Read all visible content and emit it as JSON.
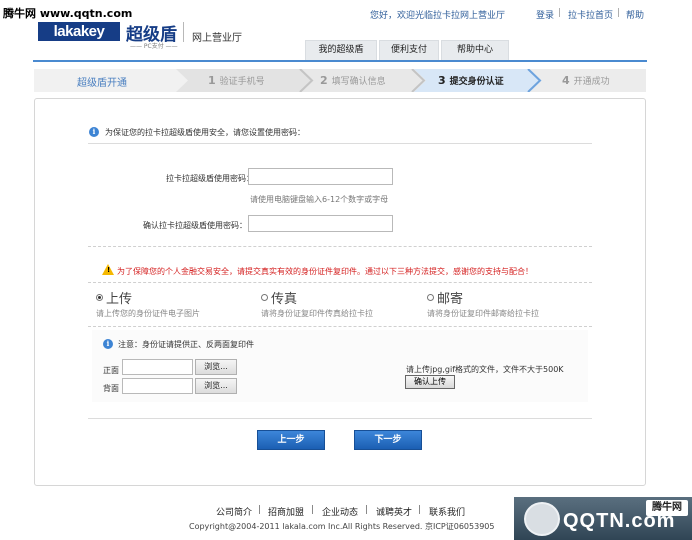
{
  "watermark": {
    "top_left": "腾牛网 www.qqtn.com",
    "bottom_right_logo": "QQTN.com",
    "bottom_right_badge": "腾牛网"
  },
  "header": {
    "logo_text": "lakakey",
    "logo_cn": "超级盾",
    "logo_sub": "—— PC支付 ——",
    "hall": "网上营业厅",
    "greeting": "您好，欢迎光临拉卡拉网上营业厅",
    "login": "登录",
    "home": "拉卡拉首页",
    "help": "帮助",
    "sep": "|",
    "nav_tabs": [
      "我的超级盾",
      "便利支付",
      "帮助中心"
    ]
  },
  "steps": {
    "title": "超级盾开通",
    "items": [
      {
        "num": "1",
        "label": "验证手机号"
      },
      {
        "num": "2",
        "label": "填写确认信息"
      },
      {
        "num": "3",
        "label": "提交身份认证"
      },
      {
        "num": "4",
        "label": "开通成功"
      }
    ],
    "active_index": 2
  },
  "form": {
    "intro": "为保证您的拉卡拉超级盾使用安全，请您设置使用密码：",
    "password_label": "拉卡拉超级盾使用密码：",
    "password_hint": "请使用电脑键盘输入6-12个数字或字母",
    "confirm_label": "确认拉卡拉超级盾使用密码：",
    "warning": "为了保障您的个人金融交易安全，请提交真实有效的身份证件复印件。通过以下三种方法提交，感谢您的支持与配合！"
  },
  "methods": [
    {
      "title": "上传",
      "desc": "请上传您的身份证件电子图片",
      "selected": true
    },
    {
      "title": "传真",
      "desc": "请将身份证复印件传真给拉卡拉",
      "selected": false
    },
    {
      "title": "邮寄",
      "desc": "请将身份证复印件邮寄给拉卡拉",
      "selected": false
    }
  ],
  "upload": {
    "notice": "注意：身份证请提供正、反两面复印件",
    "front_label": "正面",
    "back_label": "背面",
    "browse": "浏览...",
    "format_hint": "请上传jpg,gif格式的文件，文件不大于500K",
    "upload_button": "确认上传"
  },
  "buttons": {
    "prev": "上一步",
    "next": "下一步"
  },
  "footer": {
    "links": [
      "公司简介",
      "招商加盟",
      "企业动态",
      "诚聘英才",
      "联系我们"
    ],
    "copyright": "Copyright@2004-2011 lakala.com Inc.All Rights Reserved. 京ICP证06053905"
  },
  "colors": {
    "brand": "#163d86",
    "accent": "#4a8ad0",
    "warning": "#d41f1f",
    "button": "#1b5fb3"
  }
}
